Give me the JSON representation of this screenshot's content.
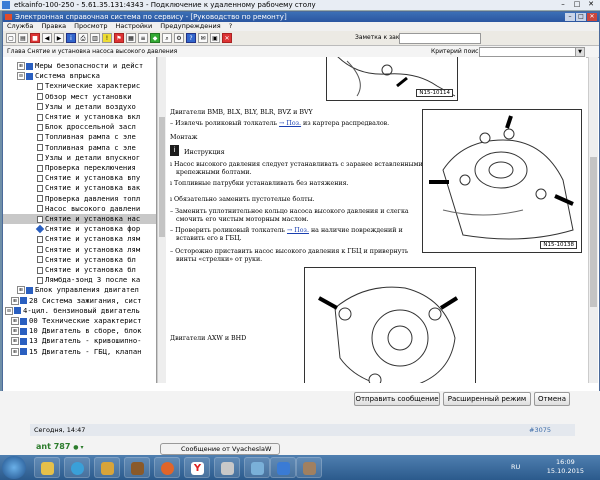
{
  "rdp": {
    "title": "etkainfo-100-250 - 5.61.35.131:4343 - Подключение к удаленному рабочему столу",
    "min": "–",
    "max": "□",
    "close": "✕"
  },
  "app": {
    "title": "Электронная справочная система по сервису - [Руководство по ремонту]",
    "menu": [
      "Служба",
      "Правка",
      "Просмотр",
      "Настройки",
      "Предупреждения",
      "?"
    ],
    "order_label": "Заметка к заказу:",
    "path": "Глава Снятие и установка насоса высокого давления",
    "criteria_label": "Критерий поиска:"
  },
  "tree": [
    {
      "indent": 14,
      "icon": "book",
      "exp": "⊞",
      "text": "Меры безопасности и дейст"
    },
    {
      "indent": 14,
      "icon": "book",
      "exp": "⊟",
      "text": "Система впрыска"
    },
    {
      "indent": 34,
      "icon": "doc",
      "text": "Технические характерис"
    },
    {
      "indent": 34,
      "icon": "doc",
      "text": "Обзор мест установки"
    },
    {
      "indent": 34,
      "icon": "doc",
      "text": "Узлы и детали воздухо"
    },
    {
      "indent": 34,
      "icon": "doc",
      "text": "Снятие и установка вкл"
    },
    {
      "indent": 34,
      "icon": "doc",
      "text": "Блок дроссельной засл"
    },
    {
      "indent": 34,
      "icon": "doc",
      "text": "Топливная рампа с  эле"
    },
    {
      "indent": 34,
      "icon": "doc",
      "text": "Топливная рампа с  эле"
    },
    {
      "indent": 34,
      "icon": "doc",
      "text": "Узлы и детали впускног"
    },
    {
      "indent": 34,
      "icon": "doc",
      "text": "Проверка переключения"
    },
    {
      "indent": 34,
      "icon": "doc",
      "text": "Снятие и установка впу"
    },
    {
      "indent": 34,
      "icon": "doc",
      "text": "Снятие и установка вак"
    },
    {
      "indent": 34,
      "icon": "doc",
      "text": "Проверка давления топл"
    },
    {
      "indent": 34,
      "icon": "doc",
      "text": "Насос высокого давлени"
    },
    {
      "indent": 34,
      "icon": "dia",
      "text": "Снятие и установка фор"
    },
    {
      "indent": 34,
      "icon": "doc",
      "text": "Снятие и установка лям"
    },
    {
      "indent": 34,
      "icon": "doc",
      "text": "Снятие и установка лям"
    },
    {
      "indent": 34,
      "icon": "doc",
      "text": "Снятие и установка  бл"
    },
    {
      "indent": 34,
      "icon": "doc",
      "text": "Снятие и установка  бл"
    },
    {
      "indent": 34,
      "icon": "doc",
      "text": "Лямбда-зонд 3 после ка"
    },
    {
      "indent": 14,
      "icon": "book",
      "exp": "⊞",
      "text": "Блок управления двигател"
    },
    {
      "indent": 8,
      "icon": "book",
      "exp": "⊞",
      "text": "28 Система зажигания, сист"
    },
    {
      "indent": 2,
      "icon": "book",
      "exp": "⊟",
      "text": "4-цил. бензиновый двигатель"
    },
    {
      "indent": 8,
      "icon": "book",
      "exp": "⊞",
      "text": "00 Технические характерист"
    },
    {
      "indent": 8,
      "icon": "book",
      "exp": "⊞",
      "text": "10 Двигатель в сборе, блок"
    },
    {
      "indent": 8,
      "icon": "book",
      "exp": "⊞",
      "text": "13 Двигатель - кривошипно-"
    },
    {
      "indent": 8,
      "icon": "book",
      "exp": "⊞",
      "text": "15 Двигатель - ГБЦ, клапан"
    }
  ],
  "tree_selected": "Снятие и установка нас",
  "content": {
    "fig1_label": "N15-10114",
    "heading1": "Двигатели BMB, BLX, BLY, BLR, BVZ и BVY",
    "l1a": "– Извлечь роликовый толкатель ",
    "l1link": "→ Поз.",
    "l1b": " из картера распредвалов.",
    "montage": "Монтаж",
    "instruction": "Инструкция",
    "n1": "Насос высокого давления следует устанавливать с заранее вставленными",
    "n1b": "крепежными болтами.",
    "n2": "Топливные патрубки устанавливать без натяжения.",
    "n3": "Обязательно заменить пустотелые болты.",
    "s1": "– Заменить уплотнительное кольцо насоса высокого давления и слегка",
    "s1b": "смочить его чистым моторным маслом.",
    "s2": "– Проверить роликовый толкатель ",
    "s2link": "→ Поз.",
    "s2b": " на наличие повреждений и",
    "s2c": "вставить его в ГБЦ.",
    "s3": "– Осторожно приставить насос высокого давления к ГБЦ и привернуть",
    "s3b": "винты «стрелки» от руки.",
    "fig2_label": "N15-10138",
    "heading2": "Двигатели AXW и BHD"
  },
  "page": {
    "btn_send": "Отправить сообщение",
    "btn_adv": "Расширенный режим",
    "btn_cancel": "Отмена",
    "post_date": "Сегодня, 14:47",
    "post_num": "#3075",
    "author": "ant 787"
  },
  "taskbar": {
    "window_label": "Сообщение от VyacheslaW",
    "lang": "RU",
    "time": "16:09",
    "date": "15.10.2015"
  }
}
